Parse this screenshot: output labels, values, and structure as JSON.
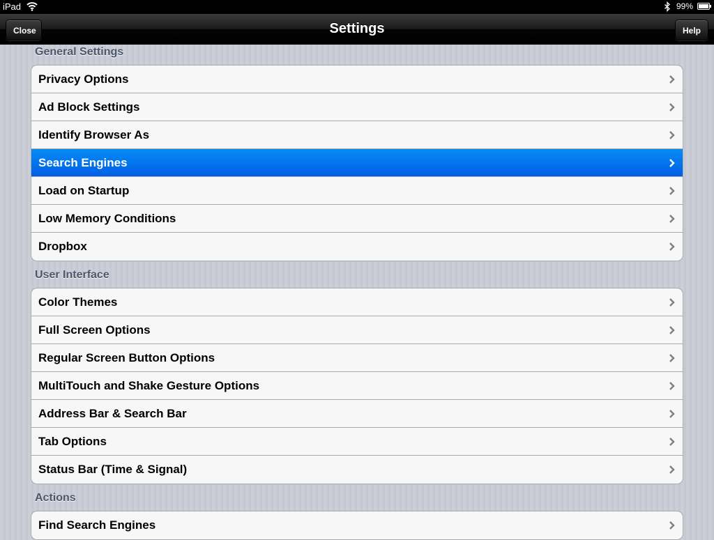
{
  "status_bar": {
    "device": "iPad",
    "battery_percent": "99%"
  },
  "nav_bar": {
    "title": "Settings",
    "left_button": "Close",
    "right_button": "Help"
  },
  "sections": [
    {
      "header": "General Settings",
      "rows": [
        {
          "label": "Privacy Options",
          "selected": false
        },
        {
          "label": "Ad Block Settings",
          "selected": false
        },
        {
          "label": "Identify Browser As",
          "selected": false
        },
        {
          "label": "Search Engines",
          "selected": true
        },
        {
          "label": "Load on Startup",
          "selected": false
        },
        {
          "label": "Low Memory Conditions",
          "selected": false
        },
        {
          "label": "Dropbox",
          "selected": false
        }
      ]
    },
    {
      "header": "User Interface",
      "rows": [
        {
          "label": "Color Themes",
          "selected": false
        },
        {
          "label": "Full Screen Options",
          "selected": false
        },
        {
          "label": "Regular Screen Button Options",
          "selected": false
        },
        {
          "label": "MultiTouch and Shake Gesture Options",
          "selected": false
        },
        {
          "label": "Address Bar & Search Bar",
          "selected": false
        },
        {
          "label": "Tab Options",
          "selected": false
        },
        {
          "label": "Status Bar (Time & Signal)",
          "selected": false
        }
      ]
    },
    {
      "header": "Actions",
      "rows": [
        {
          "label": "Find Search Engines",
          "selected": false
        }
      ]
    }
  ],
  "colors": {
    "selected_row": "#0170ee",
    "section_header": "#4c566c",
    "chevron": "#7f7f7f"
  },
  "icons": {
    "row_accessory": "chevron-right-icon",
    "wifi": "wifi-icon",
    "bluetooth": "bluetooth-icon",
    "battery": "battery-icon"
  }
}
